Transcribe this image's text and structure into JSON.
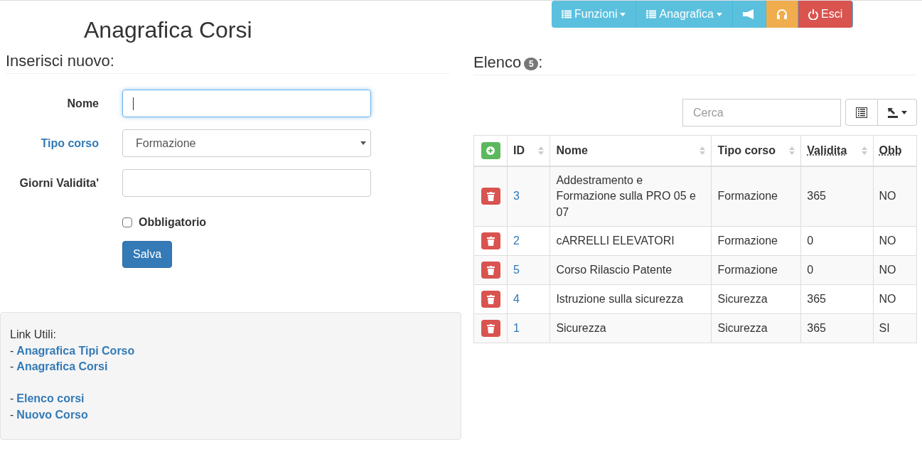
{
  "page_title": "Anagrafica Corsi",
  "nav": [
    {
      "kind": "menu",
      "label": "Funzioni",
      "color": "#5bc0de"
    },
    {
      "kind": "menu",
      "label": "Anagrafica",
      "color": "#5bc0de"
    },
    {
      "kind": "megaphone",
      "color": "#5bc0de"
    },
    {
      "kind": "headset",
      "color": "#f0ad4e"
    },
    {
      "kind": "power",
      "label": "Esci",
      "color": "#d9534f"
    }
  ],
  "form": {
    "heading": "Inserisci nuovo:",
    "fields": [
      {
        "kind": "text",
        "label": "Nome",
        "focused": true
      },
      {
        "kind": "select",
        "label": "Tipo corso",
        "value": "Formazione"
      },
      {
        "kind": "text",
        "label": "Giorni Validita'",
        "focused": false
      }
    ],
    "checkbox": {
      "label": "Obbligatorio",
      "checked": false
    },
    "submit": "Salva"
  },
  "links": {
    "title": "Link Utili:",
    "groups": [
      [
        {
          "dash": "-",
          "label": "Anagrafica Tipi Corso"
        },
        {
          "dash": "-",
          "label": "Anagrafica Corsi"
        }
      ],
      [
        {
          "dash": "-",
          "label": "Elenco corsi"
        },
        {
          "dash": "-",
          "label": "Nuovo Corso"
        }
      ]
    ]
  },
  "list": {
    "heading": "Elenco",
    "count": "5",
    "suffix": ":",
    "search": {
      "placeholder": "Cerca"
    },
    "table": {
      "columns": [
        {
          "label": "ID",
          "sortable": true,
          "abbr": false
        },
        {
          "label": "Nome",
          "sortable": true,
          "abbr": false
        },
        {
          "label": "Tipo corso",
          "sortable": true,
          "abbr": false
        },
        {
          "label": "Validita",
          "sortable": true,
          "abbr": true
        },
        {
          "label": "Obb",
          "sortable": false,
          "abbr": true
        }
      ],
      "rows": [
        {
          "id": "3",
          "nome": "Addestramento e Formazione sulla PRO 05 e 07",
          "tipo": "Formazione",
          "validita": "365",
          "obb": "NO"
        },
        {
          "id": "2",
          "nome": "cARRELLI ELEVATORI",
          "tipo": "Formazione",
          "validita": "0",
          "obb": "NO"
        },
        {
          "id": "5",
          "nome": "Corso Rilascio Patente",
          "tipo": "Formazione",
          "validita": "0",
          "obb": "NO"
        },
        {
          "id": "4",
          "nome": "Istruzione sulla sicurezza",
          "tipo": "Sicurezza",
          "validita": "365",
          "obb": "NO"
        },
        {
          "id": "1",
          "nome": "Sicurezza",
          "tipo": "Sicurezza",
          "validita": "365",
          "obb": "SI"
        }
      ]
    }
  }
}
